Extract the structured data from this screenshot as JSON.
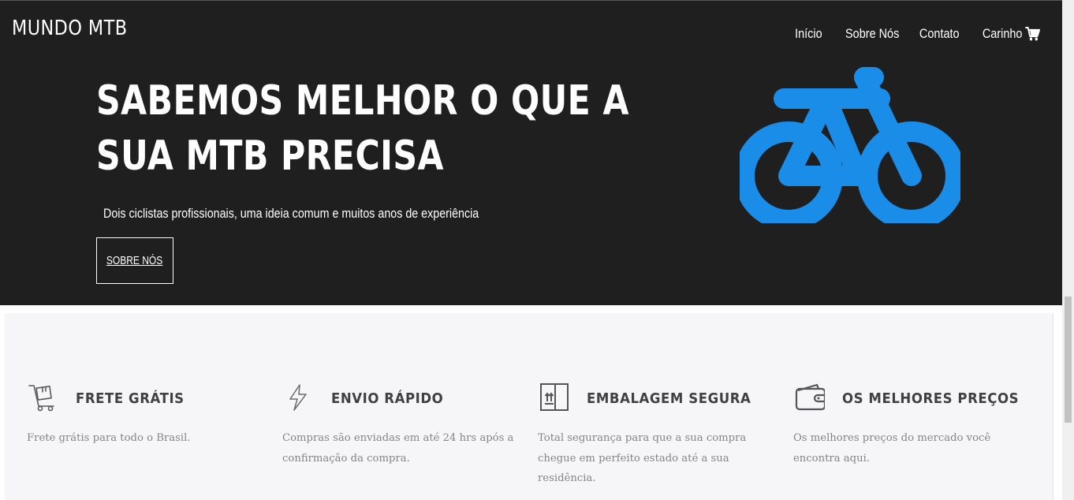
{
  "header": {
    "brand": "MUNDO MTB",
    "nav": [
      {
        "label": "Início"
      },
      {
        "label": "Sobre Nós"
      },
      {
        "label": "Contato"
      },
      {
        "label": "Carinho",
        "icon": "cart-icon"
      }
    ]
  },
  "hero": {
    "headline": "SABEMOS MELHOR O QUE A SUA MTB PRECISA",
    "subline": "Dois ciclistas profissionais, uma ideia comum e muitos anos de experiência",
    "cta_label": "SOBRE NÓS",
    "illustration": "bicycle-icon",
    "background": "#201f1f",
    "accent": "#1a8de9"
  },
  "features": [
    {
      "icon": "cart-box-icon",
      "title": "FRETE GRÁTIS",
      "description": "Frete grátis para todo o Brasil."
    },
    {
      "icon": "lightning-icon",
      "title": "ENVIO RÁPIDO",
      "description": "Compras são enviadas em até 24 hrs após a confirmação da compra."
    },
    {
      "icon": "package-icon",
      "title": "EMBALAGEM SEGURA",
      "description": "Total segurança para que a sua compra chegue em perfeito estado até a sua residência."
    },
    {
      "icon": "wallet-icon",
      "title": "OS MELHORES PREÇOS",
      "description": "Os melhores preços do mercado você encontra aqui."
    }
  ]
}
